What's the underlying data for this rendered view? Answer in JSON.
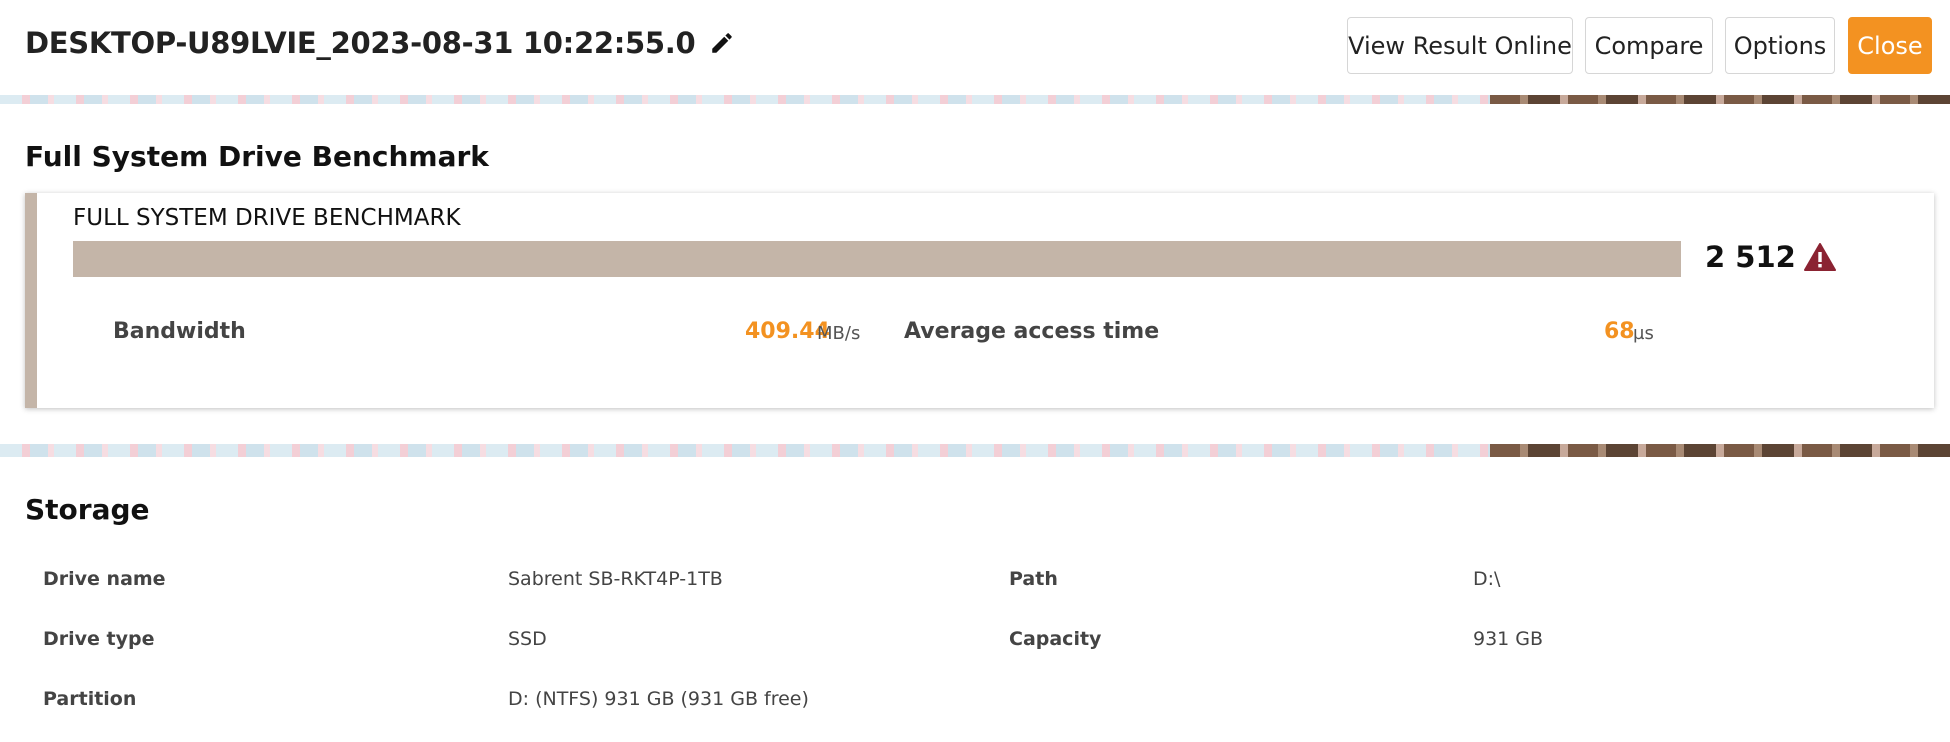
{
  "header": {
    "title": "DESKTOP-U89LVIE_2023-08-31 10:22:55.0",
    "buttons": {
      "view_online": "View Result Online",
      "compare": "Compare",
      "options": "Options",
      "close": "Close"
    }
  },
  "benchmark": {
    "section_title": "Full System Drive Benchmark",
    "card_title": "FULL SYSTEM DRIVE BENCHMARK",
    "score": "2 512",
    "bar_fill_percent": 100,
    "bandwidth_label": "Bandwidth",
    "bandwidth_value": "409.44",
    "bandwidth_unit": "MB/s",
    "access_label": "Average access time",
    "access_value": "68",
    "access_unit": "µs"
  },
  "storage": {
    "section_title": "Storage",
    "drive_name_label": "Drive name",
    "drive_name_value": "Sabrent SB-RKT4P-1TB",
    "path_label": "Path",
    "path_value": "D:\\",
    "drive_type_label": "Drive type",
    "drive_type_value": "SSD",
    "capacity_label": "Capacity",
    "capacity_value": "931 GB",
    "partition_label": "Partition",
    "partition_value": "D: (NTFS) 931 GB (931 GB free)"
  },
  "colors": {
    "accent": "#f39221",
    "bar": "#c4b5a8",
    "warning": "#8b2332"
  },
  "icons": {
    "edit": "pencil-icon",
    "warning": "warning-triangle-icon"
  }
}
